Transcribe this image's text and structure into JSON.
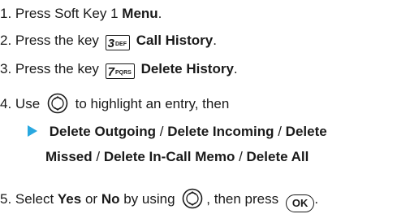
{
  "steps": [
    {
      "num": "1.",
      "pre": "Press Soft Key 1",
      "bold": "Menu",
      "post": "."
    },
    {
      "num": "2.",
      "pre": "Press the key",
      "key_num": "3",
      "key_let": "DEF",
      "bold": "Call History",
      "post": "."
    },
    {
      "num": "3.",
      "pre": "Press the key",
      "key_num": "7",
      "key_let": "PQRS",
      "bold": "Delete History",
      "post": "."
    },
    {
      "num": "4.",
      "pre": "Use",
      "post": "to highlight an entry, then"
    },
    {
      "num": "5.",
      "pre": "Select",
      "yes": "Yes",
      "or": "or",
      "no": "No",
      "mid": "by using",
      "then": ", then press",
      "ok": "OK",
      "end": "."
    }
  ],
  "options_line1": [
    "Delete Outgoing",
    "Delete Incoming",
    "Delete"
  ],
  "options_line2": [
    "Missed",
    "Delete In-Call Memo",
    "Delete All"
  ],
  "separator": " / ",
  "colors": {
    "arrow": "#29a8e0",
    "text": "#1a1a1a"
  },
  "icons": {
    "nav": "navigation-key-icon",
    "ok": "ok-key-icon",
    "arrow": "bullet-arrow-icon"
  }
}
